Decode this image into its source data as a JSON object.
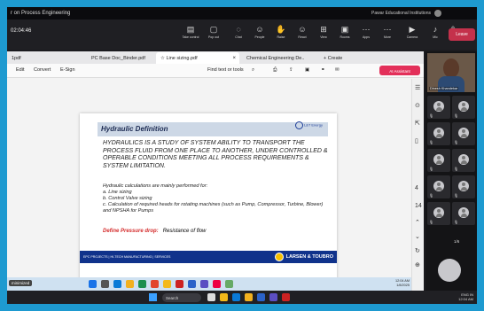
{
  "meeting": {
    "title": "r on Process Engineering",
    "org": "Pawar Educational Institutions",
    "timer": "02:04:46"
  },
  "teams_toolbar": [
    {
      "icon": "▤",
      "label": "Take control"
    },
    {
      "icon": "▢",
      "label": "Pop out"
    },
    {
      "icon": "◌",
      "label": "Chat"
    },
    {
      "icon": "☺",
      "label": "People"
    },
    {
      "icon": "✋",
      "label": "Raise"
    },
    {
      "icon": "☺",
      "label": "React"
    },
    {
      "icon": "⊞",
      "label": "View"
    },
    {
      "icon": "▣",
      "label": "Rooms"
    },
    {
      "icon": "⋯",
      "label": "Apps"
    },
    {
      "icon": "⋯",
      "label": "More"
    },
    {
      "icon": "▶",
      "label": "Camera"
    },
    {
      "icon": "♪",
      "label": "Mic"
    },
    {
      "icon": "⇪",
      "label": "Share"
    }
  ],
  "leave_label": "Leave",
  "tabs": [
    {
      "label": "1pdf",
      "active": false
    },
    {
      "label": "PC Base Doc_Binder.pdf",
      "active": false
    },
    {
      "label": "☆  Line sizing.pdf",
      "active": true
    },
    {
      "label": "Chemical Engineering De..",
      "active": false
    },
    {
      "label": "+  Create",
      "active": false
    }
  ],
  "pdf_toolbar": {
    "edit": "Edit",
    "convert": "Convert",
    "esign": "E-Sign",
    "find": "Find text or tools",
    "ai": "AI Assistant"
  },
  "slide": {
    "heading": "Hydraulic Definition",
    "logo_text": "L&T Energy",
    "paragraph1": "HYDRAULICS IS A STUDY OF SYSTEM ABILITY TO TRANSPORT THE PROCESS FLUID FROM ONE PLACE TO ANOTHER, UNDER CONTROLLED & OPERABLE CONDITIONS MEETING ALL PROCESS REQUIREMENTS & SYSTEM LIMITATION.",
    "intro": "Hydraulic calculations are mainly performed for:",
    "items": [
      "a. Line sizing",
      "b. Control Valve sizing",
      "c. Calculation of required heads for rotating machines (such as Pump, Compressor, Turbine, Blower) and NPSHA for Pumps"
    ],
    "define_label": "Define Pressure drop:",
    "define_value": "Resistance of flow",
    "footer_left": "EPC PROJECTS  |  HI-TECH MANUFACTURING  |  SERVICES",
    "footer_right": "LARSEN & TOUBRO"
  },
  "participants": {
    "presenter_name": "Dinesh Khandekar",
    "pager": "1/6"
  },
  "remote_taskbar": {
    "search": "Search",
    "tray_time": "12:04 AM",
    "tray_lang": "ENG IN"
  },
  "local_taskbar": {
    "start_label": "minimized",
    "tray_time": "12:04 AM",
    "tray_date": "1/8/2025"
  }
}
